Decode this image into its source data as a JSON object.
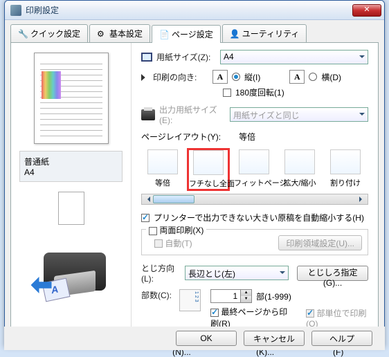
{
  "window": {
    "title": "印刷設定"
  },
  "tabs": [
    {
      "id": "quick",
      "label": "クイック設定"
    },
    {
      "id": "basic",
      "label": "基本設定"
    },
    {
      "id": "page",
      "label": "ページ設定"
    },
    {
      "id": "util",
      "label": "ユーティリティ"
    }
  ],
  "media": {
    "type": "普通紙",
    "size": "A4"
  },
  "papersize": {
    "label": "用紙サイズ(Z):",
    "value": "A4"
  },
  "orient": {
    "label": "印刷の向き:",
    "portrait": "縦(I)",
    "landscape": "横(D)",
    "rotate": "180度回転(1)"
  },
  "outsize": {
    "label": "出力用紙サイズ(E):",
    "value": "用紙サイズと同じ"
  },
  "layout": {
    "label": "ページレイアウト(Y):",
    "current": "等倍",
    "items": [
      "等倍",
      "フチなし全面",
      "フィットページ",
      "拡大/縮小",
      "割り付け"
    ]
  },
  "autoshrink": "プリンターで出力できない大きい原稿を自動縮小する(H)",
  "duplex": {
    "legend": "両面印刷(X)",
    "auto": "自動(T)",
    "areabtn": "印刷領域設定(U)..."
  },
  "bind": {
    "label": "とじ方向(L):",
    "value": "長辺とじ(左)",
    "btn": "とじしろ指定(G)..."
  },
  "copies": {
    "label": "部数(C):",
    "value": "1",
    "range": "部(1-999)",
    "lastpage": "最終ページから印刷(R)",
    "collate": "部単位で印刷(O)"
  },
  "bottom": {
    "opt": "印刷オプション(N)...",
    "stamp": "スタンプ/背景(K)...",
    "default": "標準に戻す(F)"
  },
  "footer": {
    "ok": "OK",
    "cancel": "キャンセル",
    "help": "ヘルプ"
  }
}
